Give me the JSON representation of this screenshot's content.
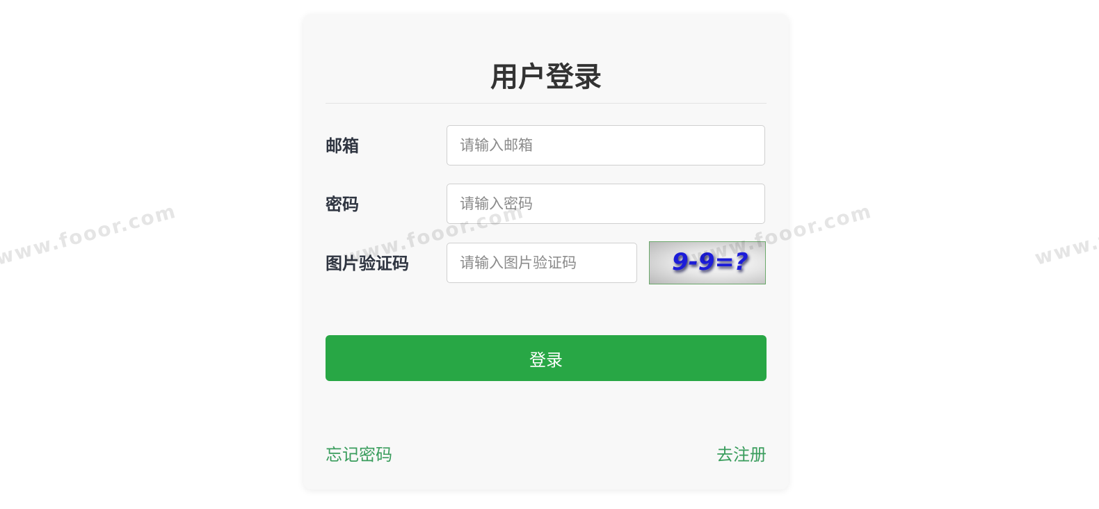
{
  "watermark": {
    "text": "www.fooor.com"
  },
  "login": {
    "title": "用户登录",
    "email": {
      "label": "邮箱",
      "placeholder": "请输入邮箱"
    },
    "password": {
      "label": "密码",
      "placeholder": "请输入密码"
    },
    "captcha": {
      "label": "图片验证码",
      "placeholder": "请输入图片验证码",
      "image_text": "9-9=?"
    },
    "submit_label": "登录",
    "forgot_label": "忘记密码",
    "register_label": "去注册"
  },
  "colors": {
    "primary_button": "#28a745",
    "link": "#3a9d5d",
    "captcha_text": "#1a1ad8"
  }
}
